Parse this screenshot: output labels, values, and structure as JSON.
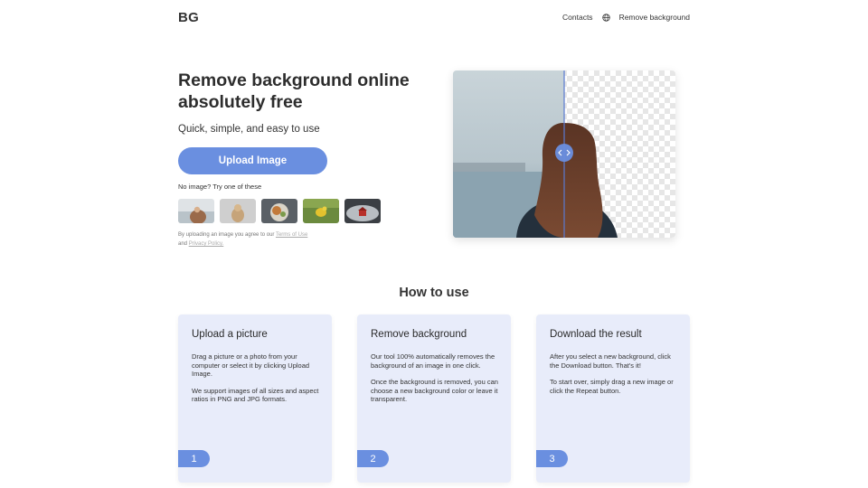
{
  "nav": {
    "logo": "BG",
    "contacts": "Contacts",
    "language_icon": "globe-icon",
    "remove_background": "Remove background"
  },
  "hero": {
    "title": "Remove background online absolutely free",
    "subtitle": "Quick, simple, and easy to use",
    "upload_button": "Upload Image",
    "no_image": "No image? Try one of these",
    "terms_prefix": "By uploading an image you agree to our",
    "terms_link": "Terms of Use",
    "terms_and": "and",
    "privacy_link": "Privacy Policy."
  },
  "how_to": {
    "title": "How to use",
    "cards": [
      {
        "title": "Upload a picture",
        "paragraphs": [
          "Drag a picture or a photo from your computer or select it by clicking Upload Image.",
          "We support images of all sizes and aspect ratios in PNG and JPG formats."
        ],
        "step": "1"
      },
      {
        "title": "Remove background",
        "paragraphs": [
          "Our tool 100% automatically removes the background of an image in one click.",
          "Once the background is removed, you can choose a new background color or leave it transparent."
        ],
        "step": "2"
      },
      {
        "title": "Download the result",
        "paragraphs": [
          "After you select a new background, click the Download button. That's it!",
          "To start over, simply drag a new image or click the Repeat button."
        ],
        "step": "3"
      }
    ]
  },
  "colors": {
    "accent": "#6a8fe0",
    "card_bg": "#e8ecfa"
  }
}
